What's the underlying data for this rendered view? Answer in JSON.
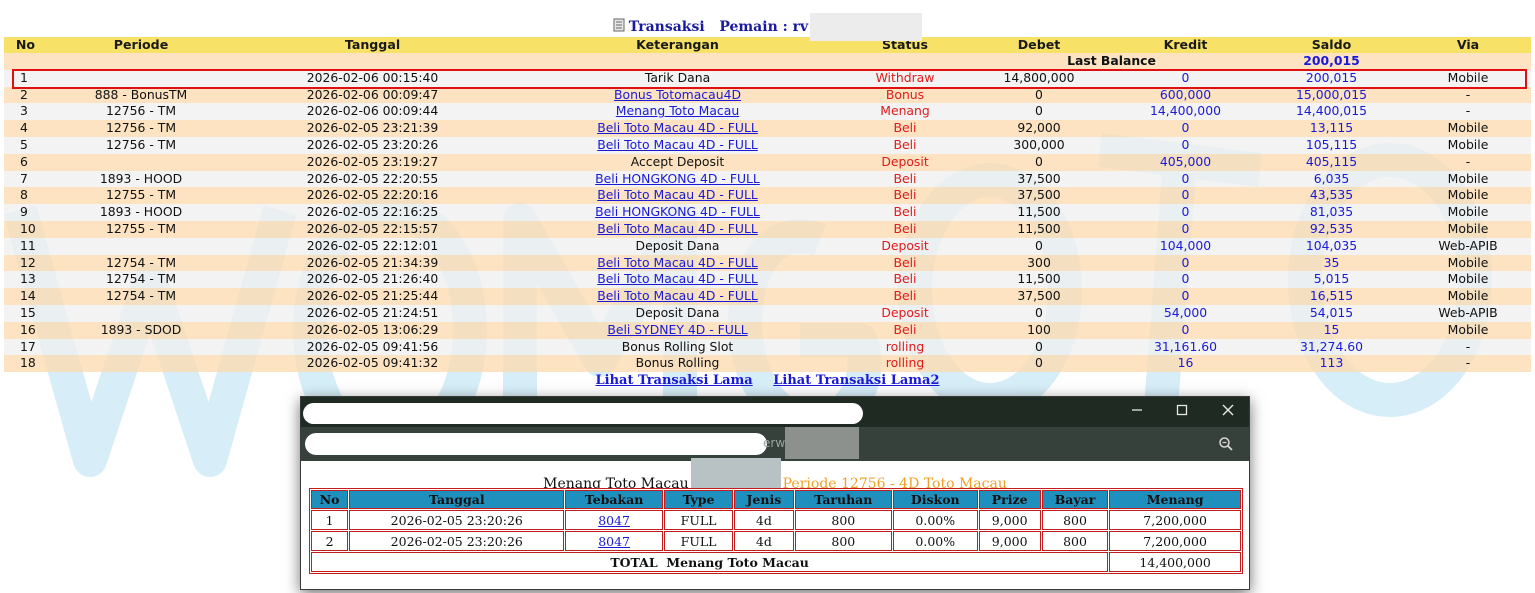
{
  "header": {
    "title": "Transaksi",
    "player_label": "Pemain : rv"
  },
  "columns": [
    "No",
    "Periode",
    "Tanggal",
    "Keterangan",
    "Status",
    "Debet",
    "Kredit",
    "Saldo",
    "Via"
  ],
  "last_balance": {
    "label": "Last Balance",
    "value": "200,015"
  },
  "rows": [
    {
      "no": "1",
      "periode": "",
      "tanggal": "2026-02-06 00:15:40",
      "keterangan": "Tarik Dana",
      "link": false,
      "status": "Withdraw",
      "debet": "14,800,000",
      "kredit": "0",
      "saldo": "200,015",
      "via": "Mobile"
    },
    {
      "no": "2",
      "periode": "888 - BonusTM",
      "tanggal": "2026-02-06 00:09:47",
      "keterangan": "Bonus Totomacau4D",
      "link": true,
      "status": "Bonus",
      "debet": "0",
      "kredit": "600,000",
      "saldo": "15,000,015",
      "via": "-"
    },
    {
      "no": "3",
      "periode": "12756 - TM",
      "tanggal": "2026-02-06 00:09:44",
      "keterangan": "Menang Toto Macau",
      "link": true,
      "status": "Menang",
      "debet": "0",
      "kredit": "14,400,000",
      "saldo": "14,400,015",
      "via": "-"
    },
    {
      "no": "4",
      "periode": "12756 - TM",
      "tanggal": "2026-02-05 23:21:39",
      "keterangan": "Beli Toto Macau 4D - FULL",
      "link": true,
      "status": "Beli",
      "debet": "92,000",
      "kredit": "0",
      "saldo": "13,115",
      "via": "Mobile"
    },
    {
      "no": "5",
      "periode": "12756 - TM",
      "tanggal": "2026-02-05 23:20:26",
      "keterangan": "Beli Toto Macau 4D - FULL",
      "link": true,
      "status": "Beli",
      "debet": "300,000",
      "kredit": "0",
      "saldo": "105,115",
      "via": "Mobile"
    },
    {
      "no": "6",
      "periode": "",
      "tanggal": "2026-02-05 23:19:27",
      "keterangan": "Accept Deposit",
      "link": false,
      "status": "Deposit",
      "debet": "0",
      "kredit": "405,000",
      "saldo": "405,115",
      "via": "-"
    },
    {
      "no": "7",
      "periode": "1893 - HOOD",
      "tanggal": "2026-02-05 22:20:55",
      "keterangan": "Beli HONGKONG 4D - FULL",
      "link": true,
      "status": "Beli",
      "debet": "37,500",
      "kredit": "0",
      "saldo": "6,035",
      "via": "Mobile"
    },
    {
      "no": "8",
      "periode": "12755 - TM",
      "tanggal": "2026-02-05 22:20:16",
      "keterangan": "Beli Toto Macau 4D - FULL",
      "link": true,
      "status": "Beli",
      "debet": "37,500",
      "kredit": "0",
      "saldo": "43,535",
      "via": "Mobile"
    },
    {
      "no": "9",
      "periode": "1893 - HOOD",
      "tanggal": "2026-02-05 22:16:25",
      "keterangan": "Beli HONGKONG 4D - FULL",
      "link": true,
      "status": "Beli",
      "debet": "11,500",
      "kredit": "0",
      "saldo": "81,035",
      "via": "Mobile"
    },
    {
      "no": "10",
      "periode": "12755 - TM",
      "tanggal": "2026-02-05 22:15:57",
      "keterangan": "Beli Toto Macau 4D - FULL",
      "link": true,
      "status": "Beli",
      "debet": "11,500",
      "kredit": "0",
      "saldo": "92,535",
      "via": "Mobile"
    },
    {
      "no": "11",
      "periode": "",
      "tanggal": "2026-02-05 22:12:01",
      "keterangan": "Deposit Dana",
      "link": false,
      "status": "Deposit",
      "debet": "0",
      "kredit": "104,000",
      "saldo": "104,035",
      "via": "Web-APIB"
    },
    {
      "no": "12",
      "periode": "12754 - TM",
      "tanggal": "2026-02-05 21:34:39",
      "keterangan": "Beli Toto Macau 4D - FULL",
      "link": true,
      "status": "Beli",
      "debet": "300",
      "kredit": "0",
      "saldo": "35",
      "via": "Mobile"
    },
    {
      "no": "13",
      "periode": "12754 - TM",
      "tanggal": "2026-02-05 21:26:40",
      "keterangan": "Beli Toto Macau 4D - FULL",
      "link": true,
      "status": "Beli",
      "debet": "11,500",
      "kredit": "0",
      "saldo": "5,015",
      "via": "Mobile"
    },
    {
      "no": "14",
      "periode": "12754 - TM",
      "tanggal": "2026-02-05 21:25:44",
      "keterangan": "Beli Toto Macau 4D - FULL",
      "link": true,
      "status": "Beli",
      "debet": "37,500",
      "kredit": "0",
      "saldo": "16,515",
      "via": "Mobile"
    },
    {
      "no": "15",
      "periode": "",
      "tanggal": "2026-02-05 21:24:51",
      "keterangan": "Deposit Dana",
      "link": false,
      "status": "Deposit",
      "debet": "0",
      "kredit": "54,000",
      "saldo": "54,015",
      "via": "Web-APIB"
    },
    {
      "no": "16",
      "periode": "1893 - SDOD",
      "tanggal": "2026-02-05 13:06:29",
      "keterangan": "Beli SYDNEY 4D - FULL",
      "link": true,
      "status": "Beli",
      "debet": "100",
      "kredit": "0",
      "saldo": "15",
      "via": "Mobile"
    },
    {
      "no": "17",
      "periode": "",
      "tanggal": "2026-02-05 09:41:56",
      "keterangan": "Bonus Rolling Slot",
      "link": false,
      "status": "rolling",
      "debet": "0",
      "kredit": "31,161.60",
      "saldo": "31,274.60",
      "via": "-"
    },
    {
      "no": "18",
      "periode": "",
      "tanggal": "2026-02-05 09:41:32",
      "keterangan": "Bonus Rolling",
      "link": false,
      "status": "rolling",
      "debet": "0",
      "kredit": "16",
      "saldo": "113",
      "via": "-"
    }
  ],
  "links": {
    "old": "Lihat Transaksi Lama",
    "old2": "Lihat Transaksi Lama2"
  },
  "popup": {
    "address_partial": "erw",
    "title_left": "Menang Toto Macau",
    "title_right": "Periode 12756 - 4D Toto Macau",
    "columns": [
      "No",
      "Tanggal",
      "Tebakan",
      "Type",
      "Jenis",
      "Taruhan",
      "Diskon",
      "Prize",
      "Bayar",
      "Menang"
    ],
    "rows": [
      {
        "no": "1",
        "tanggal": "2026-02-05 23:20:26",
        "tebakan": "8047",
        "type": "FULL",
        "jenis": "4d",
        "taruhan": "800",
        "diskon": "0.00%",
        "prize": "9,000",
        "bayar": "800",
        "menang": "7,200,000"
      },
      {
        "no": "2",
        "tanggal": "2026-02-05 23:20:26",
        "tebakan": "8047",
        "type": "FULL",
        "jenis": "4d",
        "taruhan": "800",
        "diskon": "0.00%",
        "prize": "9,000",
        "bayar": "800",
        "menang": "7,200,000"
      }
    ],
    "total_label": "TOTAL  Menang Toto Macau",
    "total_value": "14,400,000",
    "icons": [
      "minimize-icon",
      "maximize-icon",
      "close-icon",
      "zoom-icon"
    ]
  },
  "colors": {
    "header_yellow": "#f7e267",
    "row_peach": "#fddbb0",
    "row_gray": "#f0f0f0",
    "link_blue": "#1a1ad6",
    "status_red": "#e01b1b",
    "popup_header_blue": "#1f8fbd",
    "popup_border_red": "#c21c1c",
    "orange": "#f0a028"
  }
}
